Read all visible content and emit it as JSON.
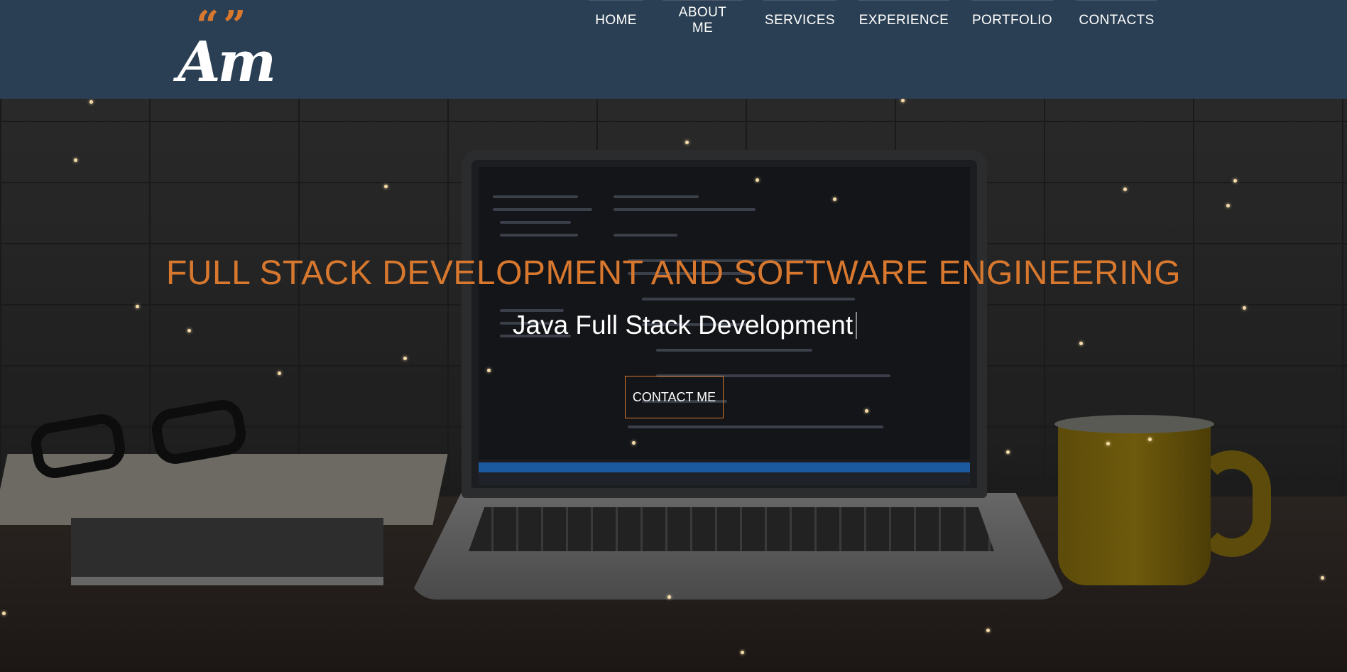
{
  "header": {
    "logo_mark": "Am",
    "logo_quotes": "“”",
    "nav": [
      {
        "id": "home",
        "label": "HOME"
      },
      {
        "id": "about",
        "label": "ABOUT ME"
      },
      {
        "id": "services",
        "label": "SERVICES"
      },
      {
        "id": "experience",
        "label": "EXPERIENCE"
      },
      {
        "id": "portfolio",
        "label": "PORTFOLIO"
      },
      {
        "id": "contacts",
        "label": "CONTACTS"
      }
    ]
  },
  "hero": {
    "title": "FULL STACK DEVELOPMENT AND SOFTWARE ENGINEERING",
    "subtitle": "Java Full Stack Development",
    "cta_label": "CONTACT ME"
  },
  "colors": {
    "header_bg": "#2a3f53",
    "accent": "#d8782f",
    "text": "#ffffff"
  }
}
